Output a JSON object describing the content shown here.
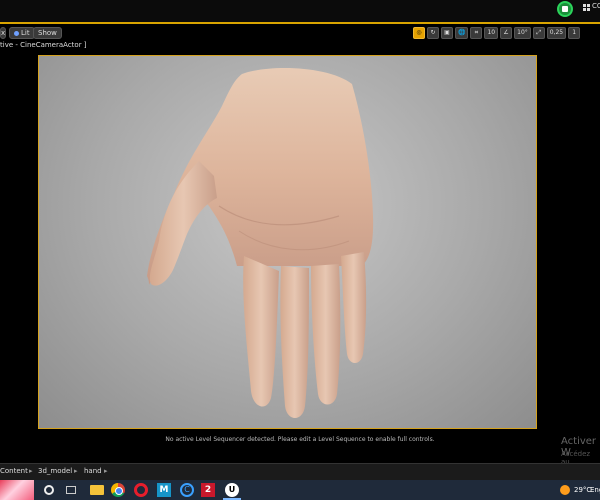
{
  "topbar": {
    "status_icon": "shield-check-icon",
    "label": "CO"
  },
  "viewport": {
    "close_label": "x",
    "lit_label": "Lit",
    "show_label": "Show",
    "camera_label": "tive - CineCameraActor ]",
    "tools": [
      {
        "name": "viewport-transform-tool",
        "label": "◎",
        "active": true
      },
      {
        "name": "rotate-tool",
        "label": "↻",
        "active": false
      },
      {
        "name": "scale-tool",
        "label": "▣",
        "active": false
      },
      {
        "name": "world-local-toggle",
        "label": "🌐",
        "active": false
      },
      {
        "name": "surface-snap-toggle",
        "label": "⌗",
        "active": false
      },
      {
        "name": "grid-snap-value",
        "label": "10",
        "active": false
      },
      {
        "name": "rotation-snap-toggle",
        "label": "∠",
        "active": false
      },
      {
        "name": "rotation-snap-value",
        "label": "10°",
        "active": false
      },
      {
        "name": "scale-snap-toggle",
        "label": "⤢",
        "active": false
      },
      {
        "name": "scale-snap-value",
        "label": "0,25",
        "active": false
      },
      {
        "name": "camera-speed",
        "label": "1",
        "active": false
      }
    ]
  },
  "sequencer_message": "No active Level Sequencer detected. Please edit a Level Sequence to enable full controls.",
  "watermark": {
    "line1": "Activer W",
    "line2": "Accédez au"
  },
  "breadcrumb": {
    "items": [
      "Content",
      "3d_model",
      "hand"
    ],
    "separator": "▸"
  },
  "taskbar": {
    "m_label": "M",
    "c_label": "C",
    "two_label": "2",
    "ue_label": "U",
    "temperature": "29°C",
    "language": "Eng"
  },
  "colors": {
    "accent": "#d9a400",
    "status": "#2bd45b"
  }
}
